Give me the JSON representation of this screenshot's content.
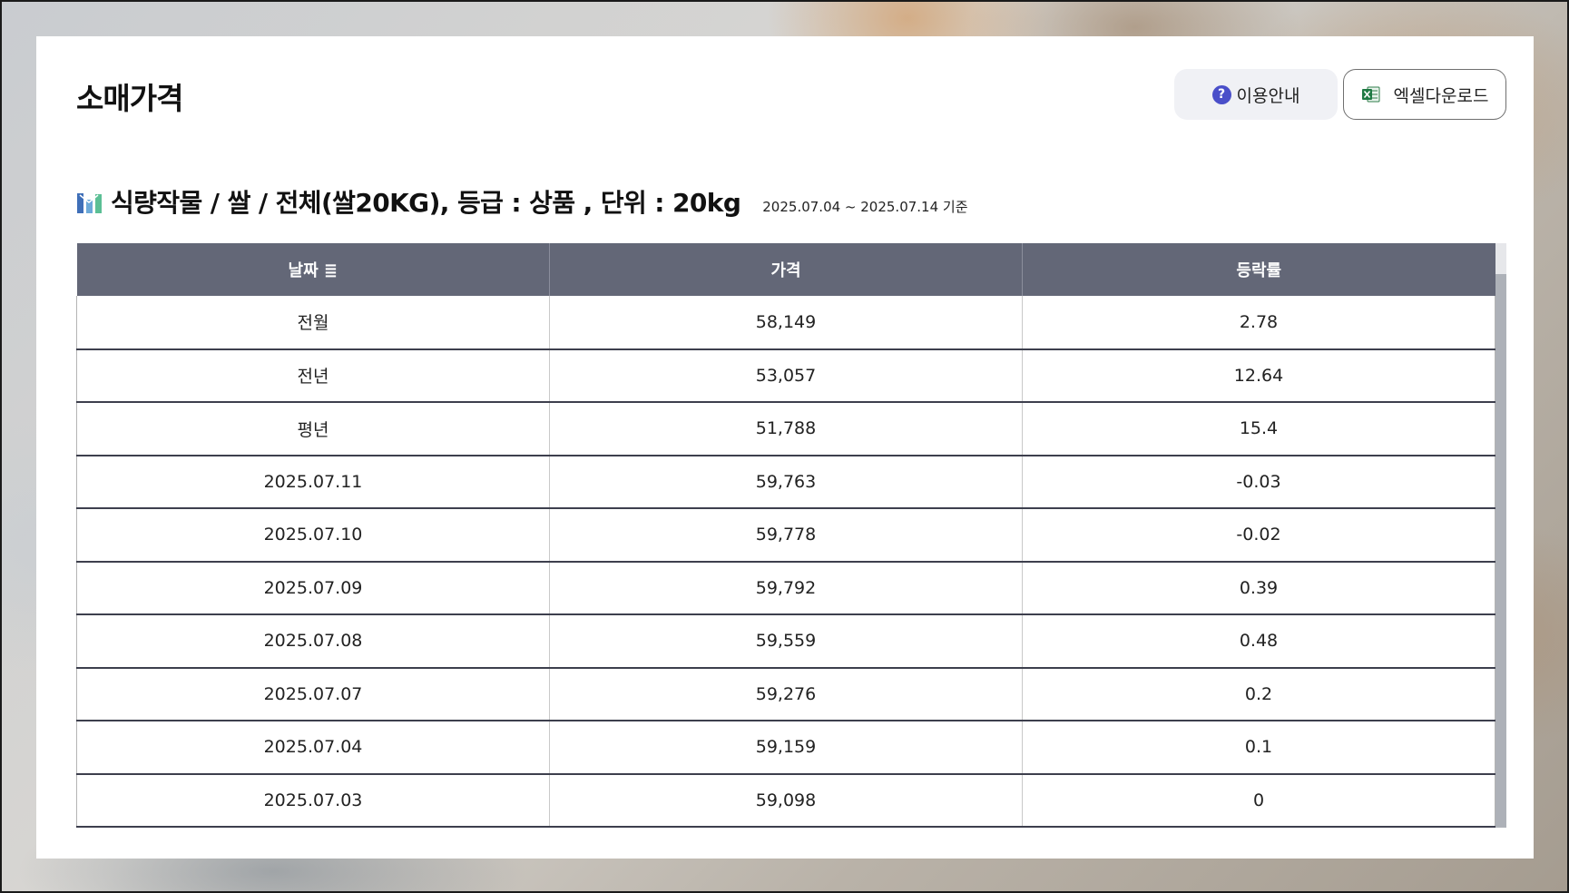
{
  "page": {
    "title": "소매가격"
  },
  "toolbar": {
    "guide_label": "이용안내",
    "guide_icon": "question-circle-icon",
    "excel_label": "엑셀다운로드",
    "excel_icon": "excel-file-icon"
  },
  "section": {
    "title": "식량작물 / 쌀 / 전체(쌀20KG), 등급 : 상품 , 단위 : 20kg",
    "period": "2025.07.04 ~ 2025.07.14 기준",
    "icon": "bar-chart-icon"
  },
  "table": {
    "columns": [
      "날짜 ≣",
      "가격",
      "등락률"
    ],
    "rows": [
      [
        "전월",
        "58,149",
        "2.78"
      ],
      [
        "전년",
        "53,057",
        "12.64"
      ],
      [
        "평년",
        "51,788",
        "15.4"
      ],
      [
        "2025.07.11",
        "59,763",
        "-0.03"
      ],
      [
        "2025.07.10",
        "59,778",
        "-0.02"
      ],
      [
        "2025.07.09",
        "59,792",
        "0.39"
      ],
      [
        "2025.07.08",
        "59,559",
        "0.48"
      ],
      [
        "2025.07.07",
        "59,276",
        "0.2"
      ],
      [
        "2025.07.04",
        "59,159",
        "0.1"
      ],
      [
        "2025.07.03",
        "59,098",
        "0"
      ]
    ]
  },
  "colors": {
    "header_bg": "#636777",
    "guide_bg": "#f0f1f5",
    "question_icon": "#4a4fc9"
  }
}
